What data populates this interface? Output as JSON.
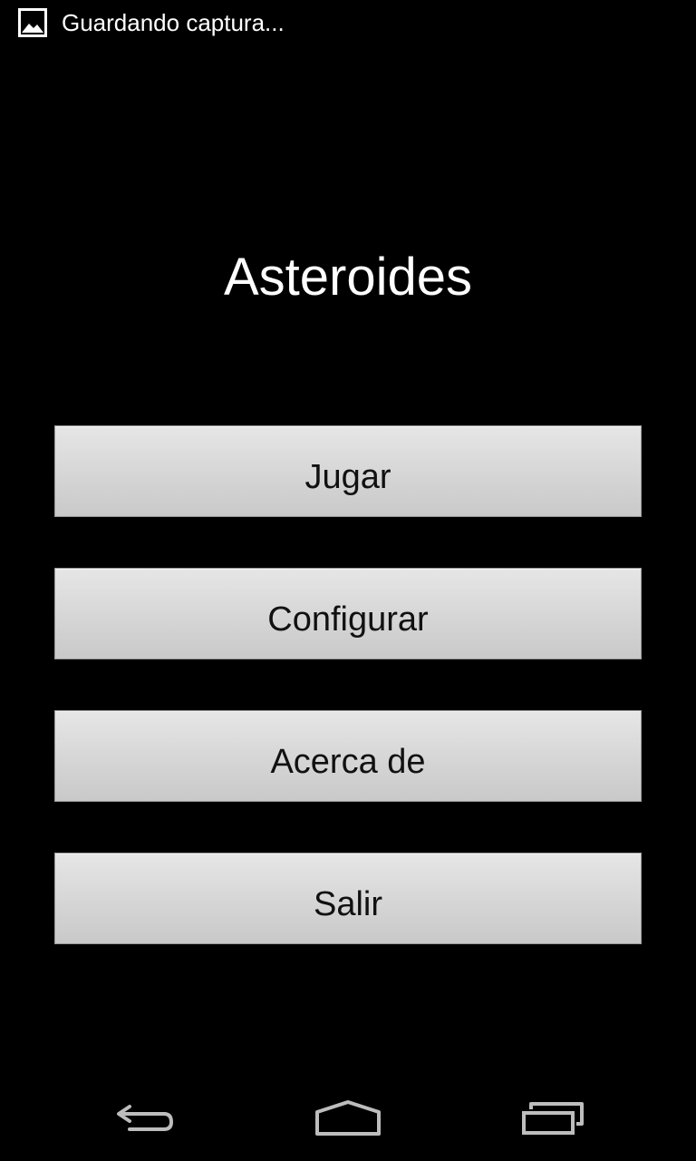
{
  "status_bar": {
    "notification_icon": "image-icon",
    "notification_text": "Guardando captura..."
  },
  "app": {
    "title": "Asteroides"
  },
  "menu": {
    "items": [
      {
        "label": "Jugar"
      },
      {
        "label": "Configurar"
      },
      {
        "label": "Acerca de"
      },
      {
        "label": "Salir"
      }
    ]
  },
  "nav_bar": {
    "icons": [
      "back-icon",
      "home-icon",
      "recents-icon"
    ]
  },
  "colors": {
    "background": "#000000",
    "button_face": "#d8d8d8",
    "button_text": "#111111",
    "title_text": "#ffffff",
    "nav_icon": "#bdbdbd"
  }
}
